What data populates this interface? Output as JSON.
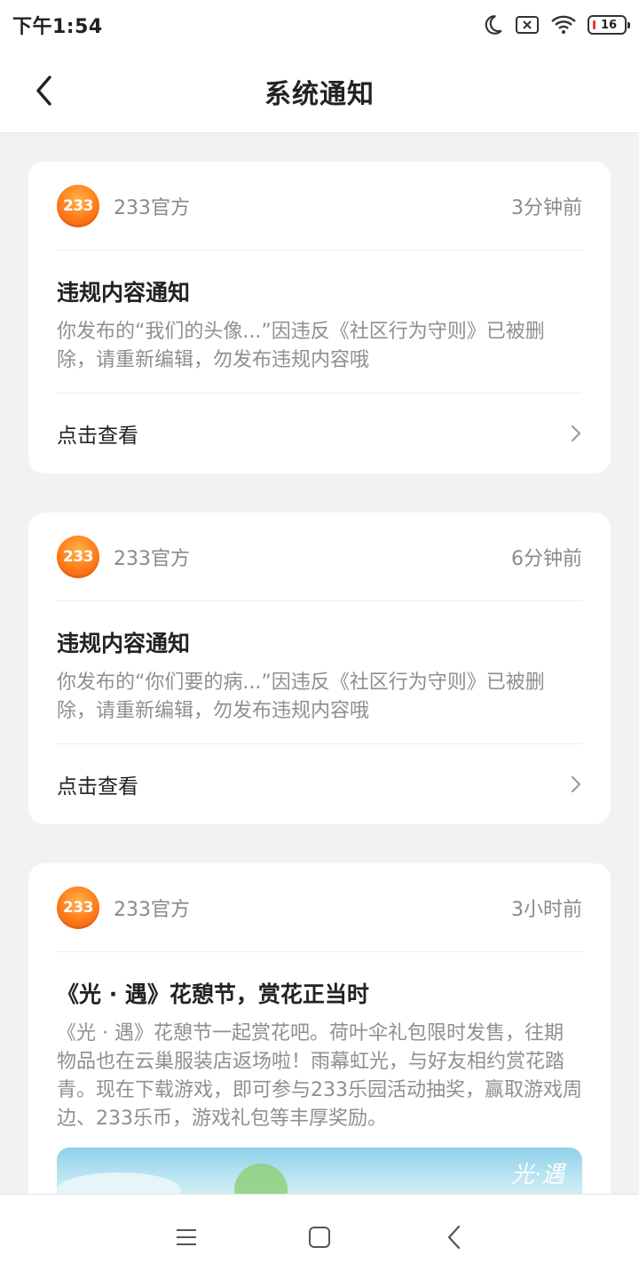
{
  "status_bar": {
    "time": "下午1:54",
    "battery_level": "16",
    "icons": [
      "moon-icon",
      "sim-x-icon",
      "wifi-icon",
      "battery-icon"
    ]
  },
  "header": {
    "title": "系统通知",
    "back_icon": "chevron-left-icon"
  },
  "notifications": [
    {
      "sender": "233官方",
      "avatar_text": "233",
      "time": "3分钟前",
      "title": "违规内容通知",
      "text": "你发布的“我们的头像...”因违反《社区行为守则》已被删除，请重新编辑，勿发布违规内容哦",
      "action_label": "点击查看"
    },
    {
      "sender": "233官方",
      "avatar_text": "233",
      "time": "6分钟前",
      "title": "违规内容通知",
      "text": "你发布的“你们要的病...”因违反《社区行为守则》已被删除，请重新编辑，勿发布违规内容哦",
      "action_label": "点击查看"
    },
    {
      "sender": "233官方",
      "avatar_text": "233",
      "time": "3小时前",
      "title": "《光 · 遇》花憩节，赏花正当时",
      "text": "《光 · 遇》花憩节一起赏花吧。荷叶伞礼包限时发售，往期物品也在云巢服装店返场啦！雨幕虹光，与好友相约赏花踏青。现在下载游戏，即可参与233乐园活动抽奖，赢取游戏周边、233乐币，游戏礼包等丰厚奖励。",
      "banner_logo": "光·遇"
    }
  ],
  "nav_bar": {
    "icons": [
      "menu-icon",
      "home-square-icon",
      "back-triangle-icon"
    ]
  },
  "colors": {
    "background": "#f2f2f2",
    "card": "#ffffff",
    "avatar_orange": "#ff7a1a",
    "secondary_text": "#8a8a8a"
  }
}
